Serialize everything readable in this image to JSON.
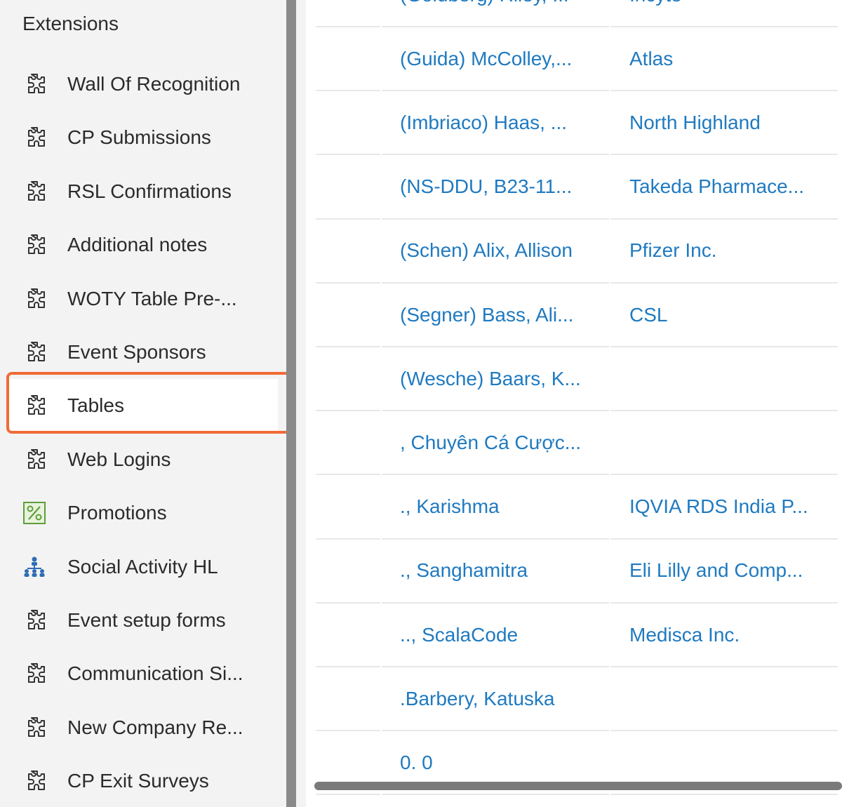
{
  "sidebar": {
    "title": "Extensions",
    "items": [
      {
        "label": "Wall Of Recognition",
        "icon": "puzzle-icon"
      },
      {
        "label": "CP Submissions",
        "icon": "puzzle-icon"
      },
      {
        "label": "RSL Confirmations",
        "icon": "puzzle-icon"
      },
      {
        "label": "Additional notes",
        "icon": "puzzle-icon"
      },
      {
        "label": "WOTY Table Pre-...",
        "icon": "puzzle-icon"
      },
      {
        "label": "Event Sponsors",
        "icon": "puzzle-icon"
      },
      {
        "label": "Tables",
        "icon": "puzzle-icon",
        "selected": true
      },
      {
        "label": "Web Logins",
        "icon": "puzzle-icon"
      },
      {
        "label": "Promotions",
        "icon": "percent-icon"
      },
      {
        "label": "Social Activity HL",
        "icon": "org-chart-icon"
      },
      {
        "label": "Event setup forms",
        "icon": "puzzle-icon"
      },
      {
        "label": "Communication Si...",
        "icon": "puzzle-icon"
      },
      {
        "label": "New Company Re...",
        "icon": "puzzle-icon"
      },
      {
        "label": "CP Exit Surveys",
        "icon": "puzzle-icon"
      }
    ]
  },
  "grid": {
    "rows": [
      {
        "name": "(Goldberg) Riley, ...",
        "company": "Incyte"
      },
      {
        "name": "(Guida) McColley,...",
        "company": "Atlas"
      },
      {
        "name": "(Imbriaco) Haas, ...",
        "company": "North Highland"
      },
      {
        "name": "(NS-DDU, B23-11...",
        "company": "Takeda Pharmace..."
      },
      {
        "name": "(Schen) Alix, Allison",
        "company": "Pfizer Inc."
      },
      {
        "name": "(Segner) Bass, Ali...",
        "company": "CSL"
      },
      {
        "name": "(Wesche) Baars, K...",
        "company": ""
      },
      {
        "name": ", Chuyên Cá Cược...",
        "company": ""
      },
      {
        "name": "., Karishma",
        "company": "IQVIA RDS India P..."
      },
      {
        "name": "., Sanghamitra",
        "company": "Eli Lilly and Comp..."
      },
      {
        "name": ".., ScalaCode",
        "company": "Medisca Inc."
      },
      {
        "name": ".Barbery, Katuska",
        "company": ""
      },
      {
        "name": "0. 0",
        "company": ""
      }
    ]
  },
  "colors": {
    "accent_highlight": "#f26a36",
    "link": "#1f7ac0",
    "sidebar_bg": "#f3f3f3"
  }
}
